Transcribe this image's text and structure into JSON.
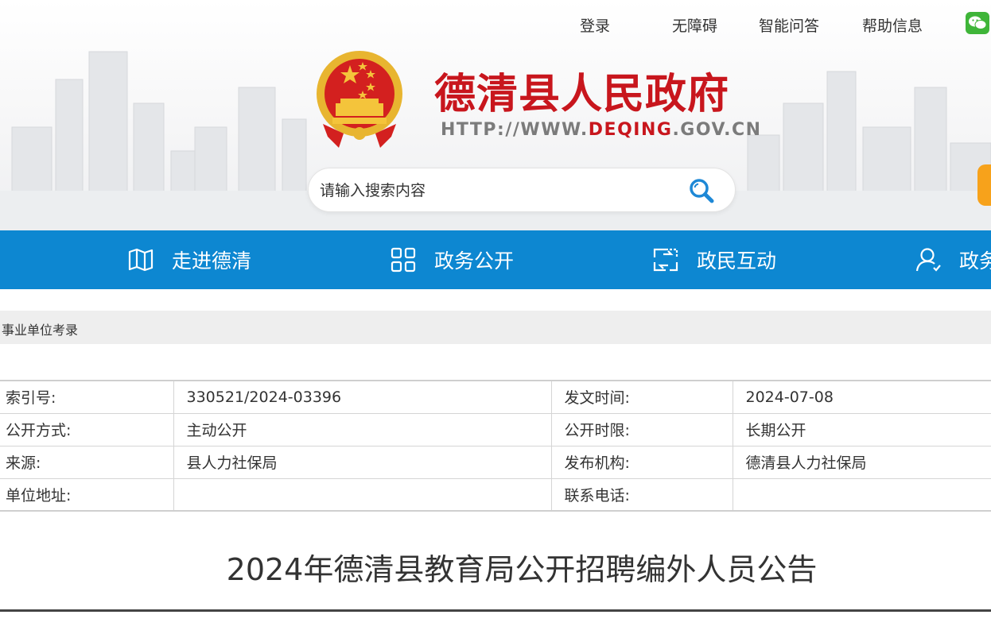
{
  "top_links": [
    "登录",
    "无障碍",
    "智能问答",
    "帮助信息"
  ],
  "header": {
    "site_title": "德清县人民政府",
    "url_prefix": "HTTP://WWW.",
    "url_accent": "DEQING",
    "url_suffix": ".GOV.CN"
  },
  "search": {
    "placeholder": "请输入搜索内容"
  },
  "nav": {
    "items": [
      {
        "label": "走进德清",
        "icon": "map-icon"
      },
      {
        "label": "政务公开",
        "icon": "grid-icon"
      },
      {
        "label": "政民互动",
        "icon": "interaction-icon"
      },
      {
        "label": "政务",
        "icon": "user-icon"
      }
    ]
  },
  "breadcrumb": "事业单位考录",
  "meta": {
    "rows": [
      [
        "索引号:",
        "330521/2024-03396",
        "发文时间:",
        "2024-07-08"
      ],
      [
        "公开方式:",
        "主动公开",
        "公开时限:",
        "长期公开"
      ],
      [
        "来源:",
        "县人力社保局",
        "发布机构:",
        "德清县人力社保局"
      ],
      [
        "单位地址:",
        "",
        "联系电话:",
        ""
      ]
    ]
  },
  "article": {
    "title": "2024年德清县教育局公开招聘编外人员公告"
  },
  "colors": {
    "brand_red": "#c8161d",
    "nav_blue": "#0d87d1",
    "wechat_green": "#3fb539",
    "side_tab": "#f7a21b"
  }
}
